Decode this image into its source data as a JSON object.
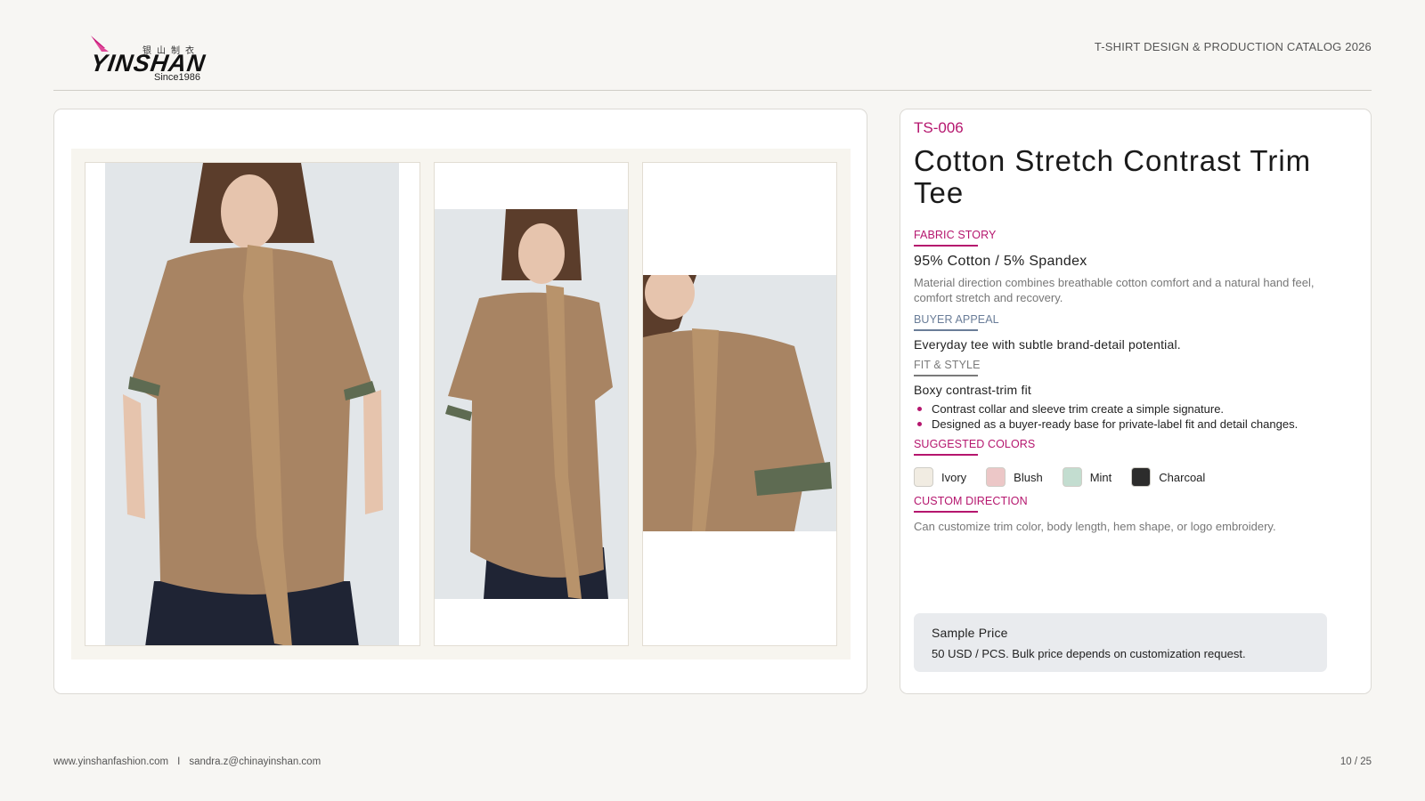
{
  "header": {
    "logo": {
      "chinese": "银山制衣",
      "wordmark": "YINSHAN",
      "since": "Since1986"
    },
    "catalog_title": "T-SHIRT DESIGN & PRODUCTION CATALOG 2026"
  },
  "product": {
    "code": "TS-006",
    "title": "Cotton Stretch Contrast Trim Tee",
    "fabric_story": {
      "label": "FABRIC STORY",
      "composition": "95% Cotton / 5% Spandex",
      "description": "Material direction combines breathable cotton comfort and a natural hand feel, comfort stretch and recovery."
    },
    "buyer_appeal": {
      "label": "BUYER APPEAL",
      "text": "Everyday tee with subtle brand-detail potential."
    },
    "fit_style": {
      "label": "FIT & STYLE",
      "fit": "Boxy contrast-trim fit",
      "bullets": [
        "Contrast collar and sleeve trim create a simple signature.",
        "Designed as a buyer-ready base for private-label fit and detail changes."
      ]
    },
    "suggested_colors": {
      "label": "SUGGESTED COLORS",
      "colors": [
        {
          "name": "Ivory",
          "hex": "#f1ece2"
        },
        {
          "name": "Blush",
          "hex": "#ecc7c7"
        },
        {
          "name": "Mint",
          "hex": "#c3ddd0"
        },
        {
          "name": "Charcoal",
          "hex": "#2c2c2c"
        }
      ]
    },
    "custom_direction": {
      "label": "CUSTOM DIRECTION",
      "text": "Can customize trim color, body length, hem shape, or logo embroidery."
    },
    "price": {
      "label": "Sample Price",
      "text": "50 USD / PCS. Bulk price depends on customization request."
    }
  },
  "footer": {
    "website": "www.yinshanfashion.com",
    "separator": "I",
    "email": "sandra.z@chinayinshan.com",
    "page": "10 / 25"
  },
  "colors": {
    "accent": "#b5166e",
    "garment": "#a88463",
    "background": "#f7f6f3"
  }
}
